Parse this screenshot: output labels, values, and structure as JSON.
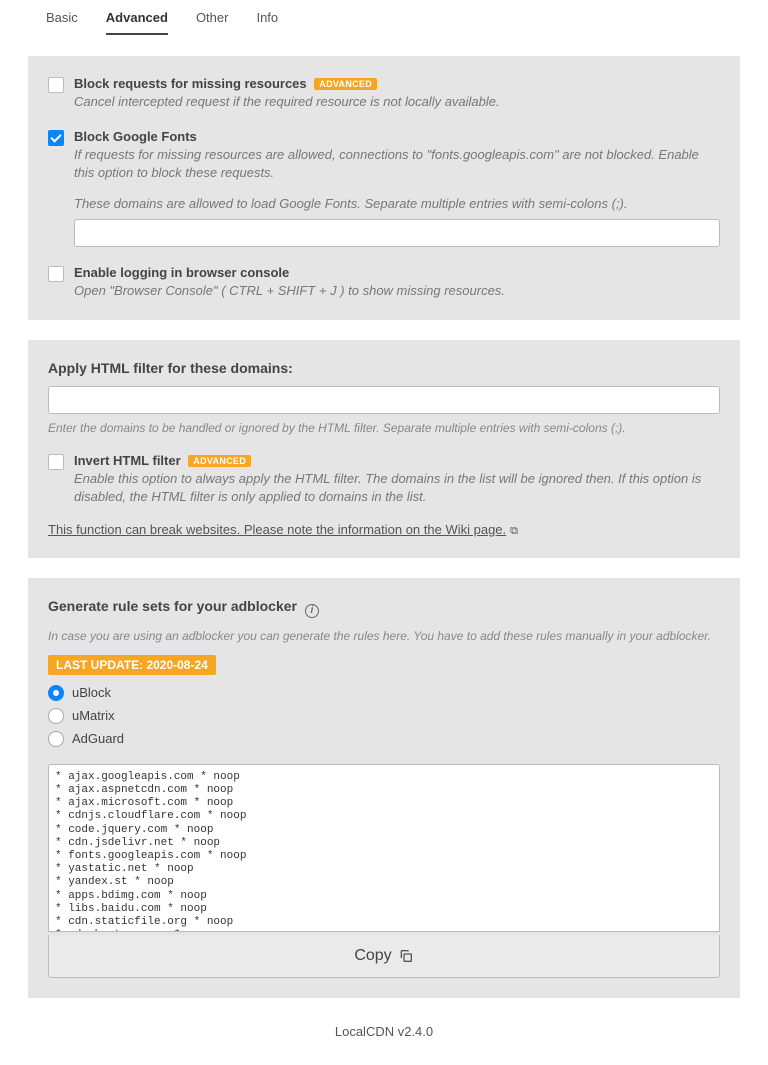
{
  "tabs": {
    "basic": "Basic",
    "advanced": "Advanced",
    "other": "Other",
    "info": "Info"
  },
  "opts": {
    "blockMissing": {
      "title": "Block requests for missing resources",
      "badge": "ADVANCED",
      "desc": "Cancel intercepted request if the required resource is not locally available."
    },
    "blockFonts": {
      "title": "Block Google Fonts",
      "desc": "If requests for missing resources are allowed, connections to \"fonts.googleapis.com\" are not blocked. Enable this option to block these requests.",
      "sub": "These domains are allowed to load Google Fonts. Separate multiple entries with semi-colons (;)."
    },
    "logging": {
      "title": "Enable logging in browser console",
      "desc": "Open \"Browser Console\" ( CTRL + SHIFT + J ) to show missing resources."
    }
  },
  "htmlFilter": {
    "title": "Apply HTML filter for these domains:",
    "hint": "Enter the domains to be handled or ignored by the HTML filter. Separate multiple entries with semi-colons (;).",
    "invert": {
      "title": "Invert HTML filter",
      "badge": "ADVANCED",
      "desc": "Enable this option to always apply the HTML filter. The domains in the list will be ignored then. If this option is disabled, the HTML filter is only applied to domains in the list."
    },
    "warn": "This function can break websites. Please note the information on the Wiki page."
  },
  "rules": {
    "title": "Generate rule sets for your adblocker",
    "desc": "In case you are using an adblocker you can generate the rules here. You have to add these rules manually in your adblocker.",
    "update": "LAST UPDATE: 2020-08-24",
    "radios": {
      "ublock": "uBlock",
      "umatrix": "uMatrix",
      "adguard": "AdGuard"
    },
    "text": "* ajax.googleapis.com * noop\n* ajax.aspnetcdn.com * noop\n* ajax.microsoft.com * noop\n* cdnjs.cloudflare.com * noop\n* code.jquery.com * noop\n* cdn.jsdelivr.net * noop\n* fonts.googleapis.com * noop\n* yastatic.net * noop\n* yandex.st * noop\n* apps.bdimg.com * noop\n* libs.baidu.com * noop\n* cdn.staticfile.org * noop\n* cdn.bootcss.com * noop",
    "copy": "Copy"
  },
  "footer": "LocalCDN v2.4.0"
}
